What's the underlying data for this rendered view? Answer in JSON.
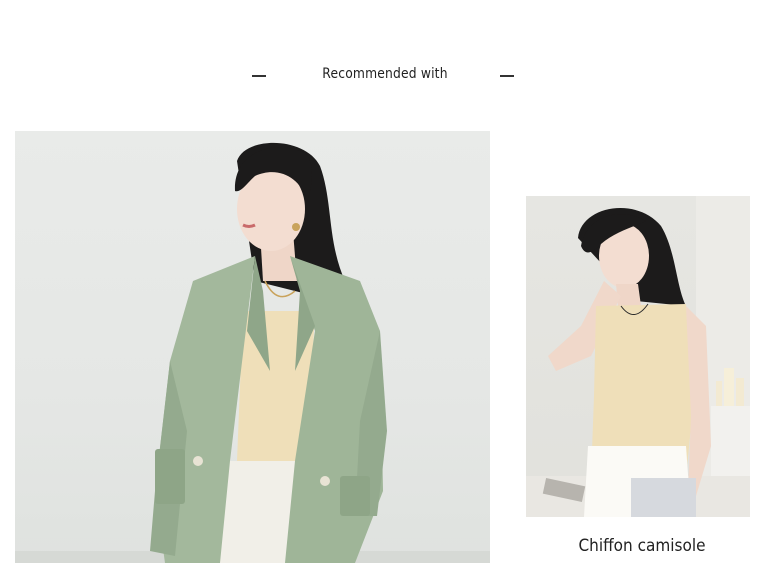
{
  "header": {
    "title": "Recommended with"
  },
  "products": [
    {
      "image": "model-green-blazer-cream-camisole",
      "caption": ""
    },
    {
      "image": "model-cream-chiffon-camisole",
      "caption": "Chiffon camisole"
    }
  ],
  "colors": {
    "blazer_green": "#a3b89c",
    "camisole_cream": "#efdfb9",
    "background_grey": "#e7e9e7"
  }
}
